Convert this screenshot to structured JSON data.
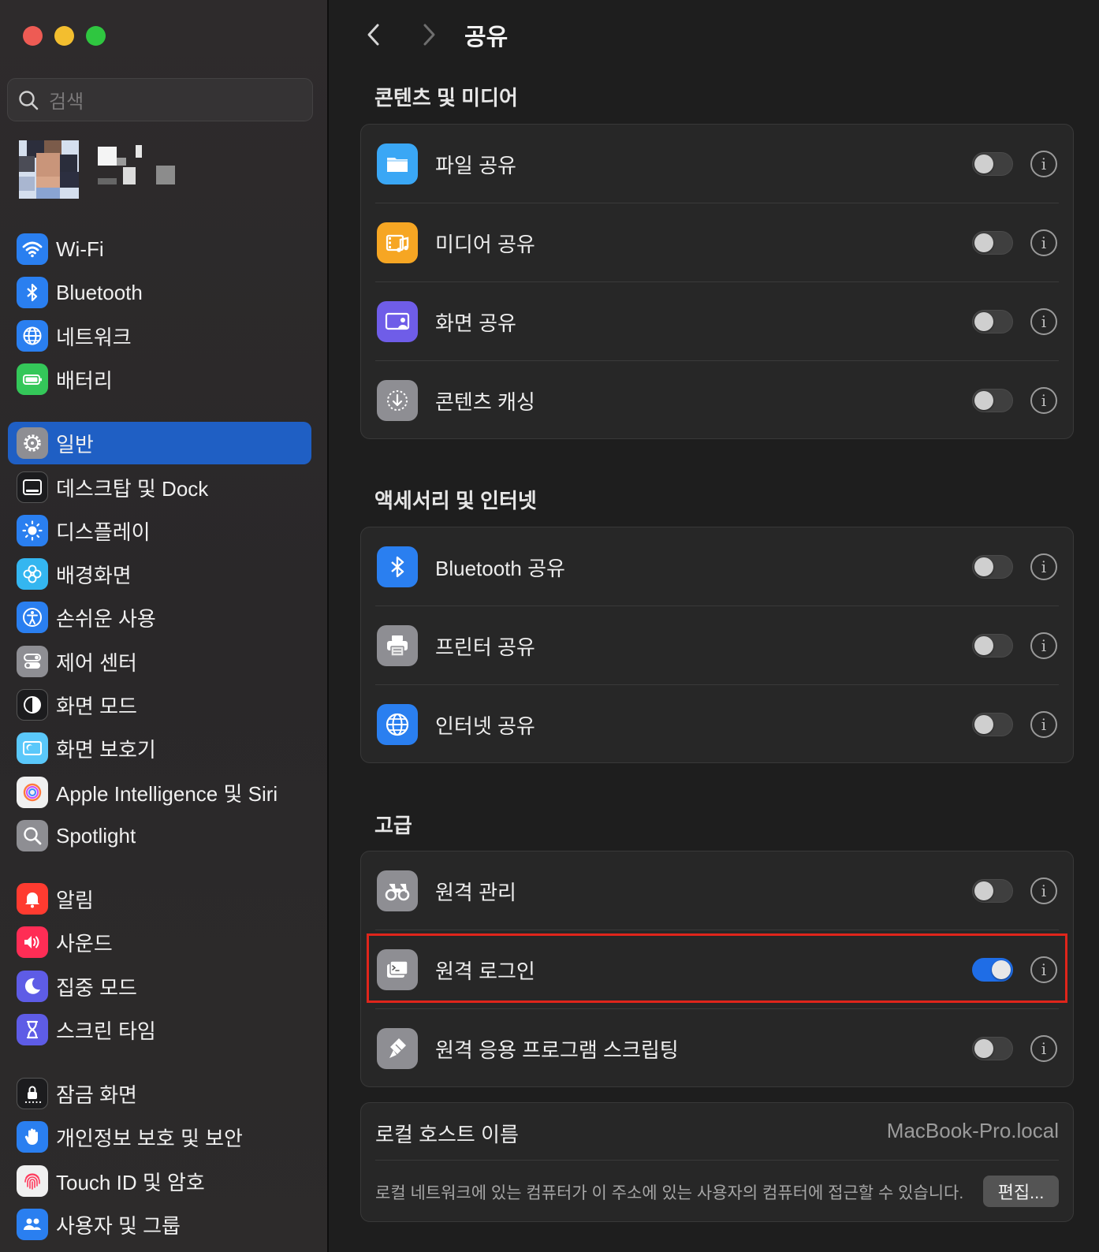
{
  "window": {
    "traffic_lights": [
      "close",
      "minimize",
      "zoom"
    ]
  },
  "search": {
    "placeholder": "검색"
  },
  "sidebar": {
    "items": [
      {
        "id": "wifi",
        "label": "Wi-Fi",
        "icon": "wifi-icon",
        "color": "#2a7ff0"
      },
      {
        "id": "bluetooth",
        "label": "Bluetooth",
        "icon": "bluetooth-icon",
        "color": "#2a7ff0"
      },
      {
        "id": "network",
        "label": "네트워크",
        "icon": "globe-icon",
        "color": "#2a7ff0"
      },
      {
        "id": "battery",
        "label": "배터리",
        "icon": "battery-icon",
        "color": "#34c759"
      },
      {
        "id": "general",
        "label": "일반",
        "icon": "gear-icon",
        "color": "#8e8e93",
        "selected": true
      },
      {
        "id": "desktop-dock",
        "label": "데스크탑 및 Dock",
        "icon": "dock-icon",
        "color": "#1c1c1e"
      },
      {
        "id": "displays",
        "label": "디스플레이",
        "icon": "sun-icon",
        "color": "#2a7ff0"
      },
      {
        "id": "wallpaper",
        "label": "배경화면",
        "icon": "flower-icon",
        "color": "#34b6f0"
      },
      {
        "id": "accessibility",
        "label": "손쉬운 사용",
        "icon": "accessibility-icon",
        "color": "#2a7ff0"
      },
      {
        "id": "control-center",
        "label": "제어 센터",
        "icon": "switches-icon",
        "color": "#8e8e93"
      },
      {
        "id": "appearance",
        "label": "화면 모드",
        "icon": "appearance-icon",
        "color": "#1c1c1e"
      },
      {
        "id": "screen-saver",
        "label": "화면 보호기",
        "icon": "screensaver-icon",
        "color": "#5ac8fa"
      },
      {
        "id": "apple-intelligence",
        "label": "Apple Intelligence 및 Siri",
        "icon": "siri-icon",
        "color": "#f0f0f0"
      },
      {
        "id": "spotlight",
        "label": "Spotlight",
        "icon": "magnifier-icon",
        "color": "#8e8e93"
      },
      {
        "id": "notifications",
        "label": "알림",
        "icon": "bell-icon",
        "color": "#ff3b30"
      },
      {
        "id": "sound",
        "label": "사운드",
        "icon": "speaker-icon",
        "color": "#ff2d55"
      },
      {
        "id": "focus",
        "label": "집중 모드",
        "icon": "moon-icon",
        "color": "#5e5ce6"
      },
      {
        "id": "screen-time",
        "label": "스크린 타임",
        "icon": "hourglass-icon",
        "color": "#5e5ce6"
      },
      {
        "id": "lock-screen",
        "label": "잠금 화면",
        "icon": "lock-icon",
        "color": "#1c1c1e"
      },
      {
        "id": "privacy",
        "label": "개인정보 보호 및 보안",
        "icon": "hand-icon",
        "color": "#2a7ff0"
      },
      {
        "id": "touch-id",
        "label": "Touch ID 및 암호",
        "icon": "fingerprint-icon",
        "color": "#f0f0f0"
      },
      {
        "id": "users",
        "label": "사용자 및 그룹",
        "icon": "users-icon",
        "color": "#2a7ff0"
      }
    ]
  },
  "header": {
    "title": "공유"
  },
  "sections": [
    {
      "title": "콘텐츠 및 미디어",
      "rows": [
        {
          "label": "파일 공유",
          "icon": "folder-icon",
          "on": false
        },
        {
          "label": "미디어 공유",
          "icon": "media-icon",
          "on": false
        },
        {
          "label": "화면 공유",
          "icon": "screen-share-icon",
          "on": false
        },
        {
          "label": "콘텐츠 캐싱",
          "icon": "download-icon",
          "on": false
        }
      ]
    },
    {
      "title": "액세서리 및 인터넷",
      "rows": [
        {
          "label": "Bluetooth 공유",
          "icon": "bluetooth-icon",
          "on": false
        },
        {
          "label": "프린터 공유",
          "icon": "printer-icon",
          "on": false
        },
        {
          "label": "인터넷 공유",
          "icon": "globe-icon",
          "on": false
        }
      ]
    },
    {
      "title": "고급",
      "rows": [
        {
          "label": "원격 관리",
          "icon": "binoculars-icon",
          "on": false
        },
        {
          "label": "원격 로그인",
          "icon": "terminal-icon",
          "on": true,
          "highlighted": true
        },
        {
          "label": "원격 응용 프로그램 스크립팅",
          "icon": "script-icon",
          "on": false
        }
      ]
    }
  ],
  "hostname": {
    "label": "로컬 호스트 이름",
    "value": "MacBook-Pro.local",
    "description": "로컬 네트워크에 있는 컴퓨터가 이 주소에 있는 사용자의 컴퓨터에 접근할 수 있습니다.",
    "edit_label": "편집..."
  },
  "info_glyph": "i",
  "colors": {
    "accent": "#1f6de6",
    "highlight": "#e0251b",
    "selected": "#1f5fc4"
  }
}
